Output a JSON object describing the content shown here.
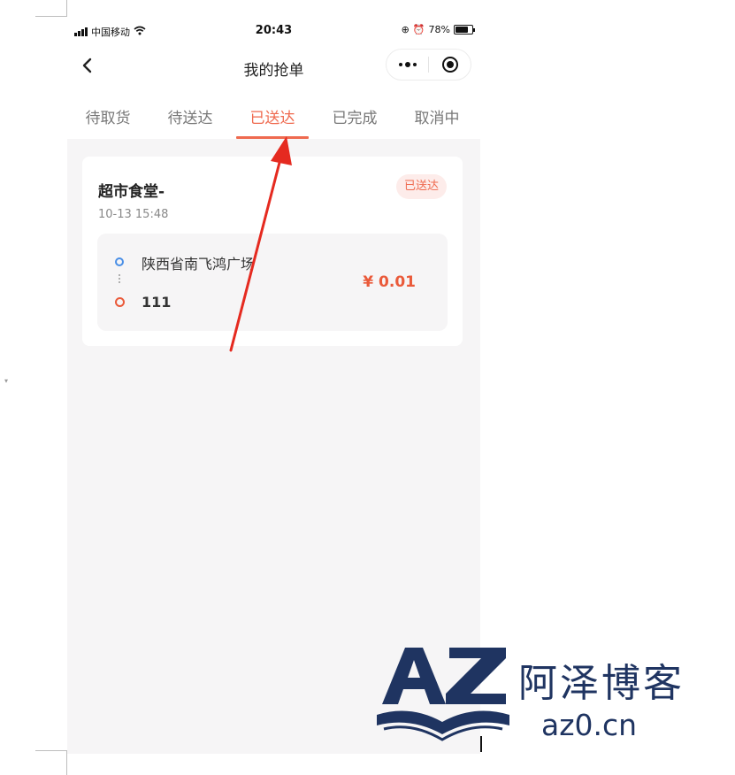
{
  "status_bar": {
    "carrier": "中国移动",
    "time": "20:43",
    "battery": "78%",
    "battery_level": 0.78
  },
  "nav": {
    "title": "我的抢单"
  },
  "tabs": [
    {
      "label": "待取货",
      "active": false
    },
    {
      "label": "待送达",
      "active": false
    },
    {
      "label": "已送达",
      "active": true
    },
    {
      "label": "已完成",
      "active": false
    },
    {
      "label": "取消中",
      "active": false
    }
  ],
  "order": {
    "shop_name": "超市食堂-",
    "time": "10-13 15:48",
    "status": "已送达",
    "pickup_address": "陕西省南飞鸿广场",
    "dropoff_address": "111",
    "price": "¥ 0.01"
  },
  "watermark": {
    "brand_cn": "阿泽博客",
    "domain": "az0.cn"
  },
  "colors": {
    "accent": "#ef6a4f",
    "price": "#ea5a3a",
    "pickup_dot": "#4a8fe6",
    "annotation_arrow": "#e52a20",
    "watermark": "#1f3461"
  }
}
